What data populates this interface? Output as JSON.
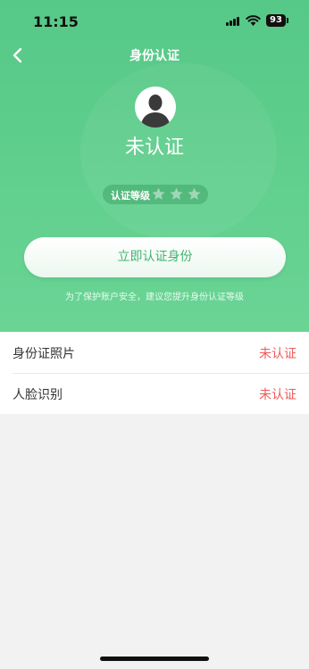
{
  "status_bar": {
    "time": "11:15",
    "battery": "93"
  },
  "nav": {
    "title": "身份认证"
  },
  "profile": {
    "status": "未认证"
  },
  "level": {
    "label": "认证等级",
    "stars_filled": 0,
    "stars_total": 3
  },
  "cta": {
    "label": "立即认证身份"
  },
  "hint": "为了保护账户安全，建议您提升身份认证等级",
  "items": [
    {
      "label": "身份证照片",
      "status": "未认证"
    },
    {
      "label": "人脸识别",
      "status": "未认证"
    }
  ],
  "colors": {
    "brand": "#56c887",
    "status_red": "#f05a5a",
    "cta_text": "#3fb56f"
  }
}
